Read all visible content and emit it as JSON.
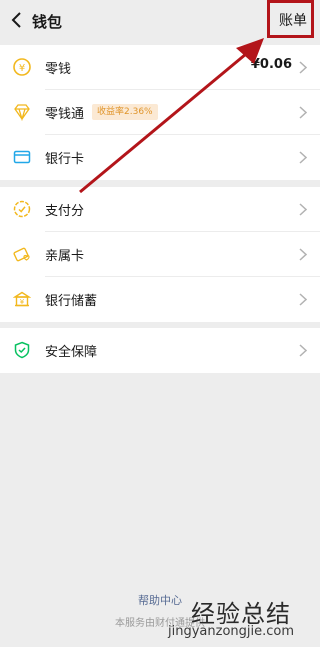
{
  "header": {
    "title": "钱包",
    "bill_label": "账单"
  },
  "group1": [
    {
      "label": "零钱",
      "amount": "¥0.06"
    },
    {
      "label": "零钱通",
      "badge": "收益率2.36%"
    },
    {
      "label": "银行卡"
    }
  ],
  "group2": [
    {
      "label": "支付分"
    },
    {
      "label": "亲属卡"
    },
    {
      "label": "银行储蓄"
    }
  ],
  "group3": [
    {
      "label": "安全保障"
    }
  ],
  "footer": {
    "help": "帮助中心",
    "service": "本服务由财付通提供"
  },
  "watermark": {
    "cn": "经验总结",
    "en": "jingyanzongjie.com"
  },
  "colors": {
    "accent": "#b3151a",
    "coin": "#f2b81e",
    "card": "#21a7e8",
    "shield": "#07c160"
  }
}
